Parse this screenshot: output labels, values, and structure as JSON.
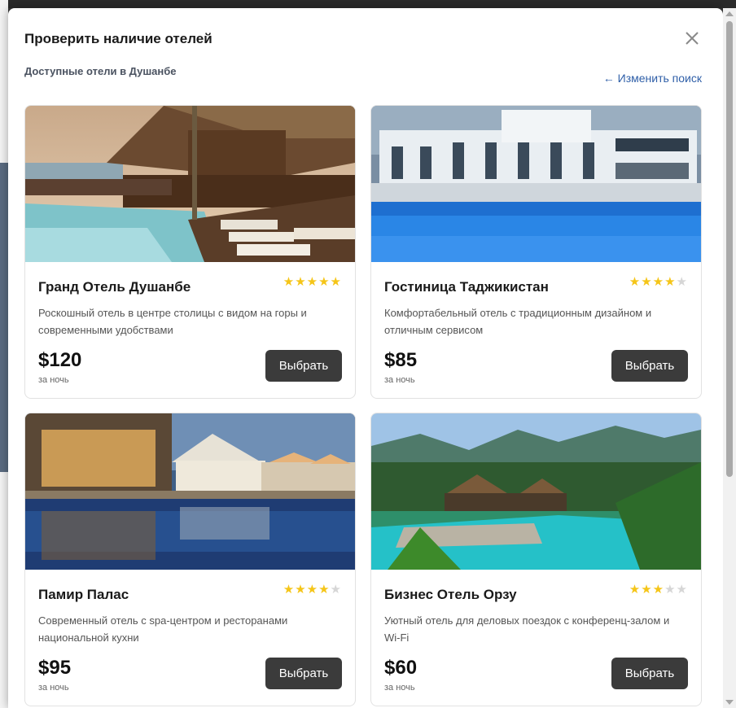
{
  "modal": {
    "title": "Проверить наличие отелей",
    "subtitle": "Доступные отели в Душанбе",
    "change_search": "← Изменить поиск",
    "close_icon": "close-icon"
  },
  "hotels": [
    {
      "name": "Гранд Отель Душанбе",
      "rating": 5,
      "stars": "★★★★★",
      "empty": "",
      "description": "Роскошный отель в центре столицы с видом на горы и современными удобствами",
      "price": "$120",
      "per": "за ночь",
      "button": "Выбрать"
    },
    {
      "name": "Гостиница Таджикистан",
      "rating": 4,
      "stars": "★★★★",
      "empty": "★",
      "description": "Комфортабельный отель с традиционным дизайном и отличным сервисом",
      "price": "$85",
      "per": "за ночь",
      "button": "Выбрать"
    },
    {
      "name": "Памир Палас",
      "rating": 4,
      "stars": "★★★★",
      "empty": "★",
      "description": "Современный отель с spa-центром и ресторанами национальной кухни",
      "price": "$95",
      "per": "за ночь",
      "button": "Выбрать"
    },
    {
      "name": "Бизнес Отель Орзу",
      "rating": 3,
      "stars": "★★★",
      "empty": "★★",
      "description": "Уютный отель для деловых поездок с конференц-залом и Wi-Fi",
      "price": "$60",
      "per": "за ночь",
      "button": "Выбрать"
    }
  ],
  "colors": {
    "accent_link": "#2f5fa8",
    "button_bg": "#3b3b3b",
    "star": "#f5c518"
  }
}
